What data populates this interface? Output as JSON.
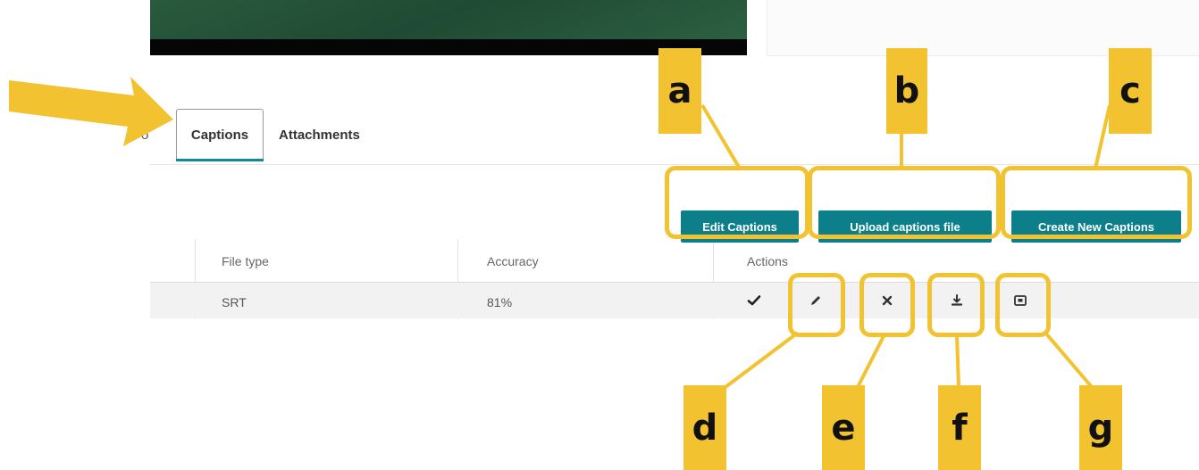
{
  "tabs": {
    "previous_fragment": "o",
    "captions": "Captions",
    "attachments": "Attachments"
  },
  "buttons": {
    "edit_captions": "Edit Captions",
    "upload_captions_file": "Upload captions file",
    "create_new_captions": "Create New Captions"
  },
  "table": {
    "columns": [
      "File type",
      "Accuracy",
      "Actions"
    ],
    "rows": [
      {
        "file_type": "SRT",
        "accuracy": "81%"
      }
    ],
    "row_actions": [
      "check-icon",
      "pencil-icon",
      "close-icon",
      "download-icon",
      "preview-icon"
    ]
  },
  "callouts": {
    "a": "a",
    "b": "b",
    "c": "c",
    "d": "d",
    "e": "e",
    "f": "f",
    "g": "g"
  },
  "colors": {
    "accent": "#0d7f8a",
    "callout": "#f2c230",
    "tab_underline": "#0e8a99",
    "banner": "#2a5a3e"
  }
}
